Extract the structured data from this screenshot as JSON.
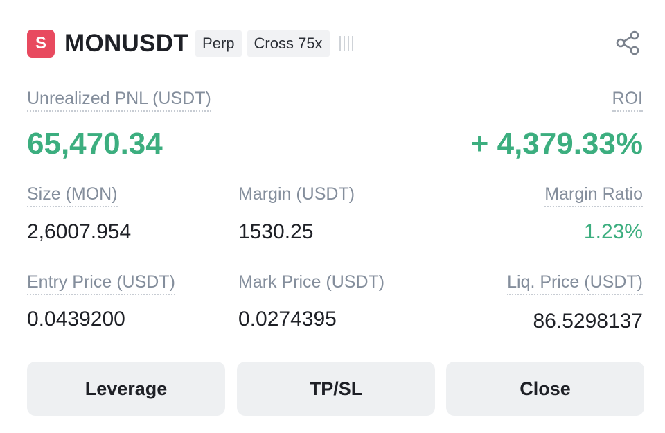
{
  "header": {
    "coin_icon_letter": "S",
    "symbol": "MONUSDT",
    "badge_type": "Perp",
    "badge_margin": "Cross 75x",
    "risk_icon": "risk-bars-icon",
    "share_icon": "share-icon"
  },
  "pnl": {
    "label": "Unrealized PNL (USDT)",
    "value": "65,470.34"
  },
  "roi": {
    "label": "ROI",
    "value": "+ 4,379.33%"
  },
  "size": {
    "label": "Size (MON)",
    "value": "2,6007.954"
  },
  "margin": {
    "label": "Margin (USDT)",
    "value": "1530.25"
  },
  "margin_ratio": {
    "label": "Margin Ratio",
    "value": "1.23%"
  },
  "entry_price": {
    "label": "Entry Price (USDT)",
    "value": "0.0439200"
  },
  "mark_price": {
    "label": "Mark Price (USDT)",
    "value": "0.0274395"
  },
  "liq_price": {
    "label": "Liq. Price (USDT)",
    "value": "86.5298137"
  },
  "buttons": {
    "leverage": "Leverage",
    "tpsl": "TP/SL",
    "close": "Close"
  },
  "colors": {
    "profit": "#3cae7f",
    "coin_icon": "#e84a5f",
    "button_bg": "#eef0f2"
  }
}
